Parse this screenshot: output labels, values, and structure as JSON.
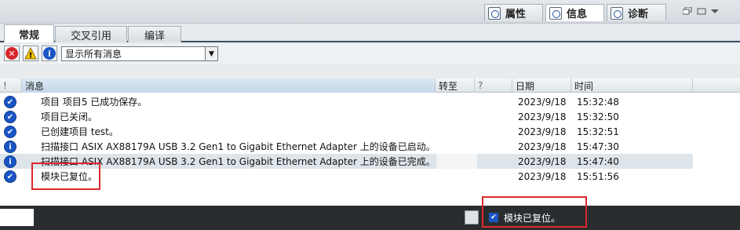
{
  "top_tabs": [
    {
      "label": "属性",
      "icon": "properties-icon",
      "active": false
    },
    {
      "label": "信息",
      "icon": "info-icon",
      "active": true
    },
    {
      "label": "诊断",
      "icon": "diagnostics-icon",
      "active": false
    }
  ],
  "sub_tabs": [
    {
      "label": "常规",
      "active": true
    },
    {
      "label": "交叉引用",
      "active": false
    },
    {
      "label": "编译",
      "active": false
    }
  ],
  "filter": {
    "selected": "显示所有消息",
    "buttons": [
      "error-filter-icon",
      "warning-filter-icon",
      "info-filter-icon"
    ]
  },
  "table": {
    "headers": {
      "flag": "!",
      "message": "消息",
      "goto": "转至",
      "help": "?",
      "date": "日期",
      "time": "时间"
    },
    "rows": [
      {
        "icon": "check-icon",
        "message": "项目 项目5 已成功保存。",
        "date": "2023/9/18",
        "time": "15:32:48"
      },
      {
        "icon": "check-icon",
        "message": "项目已关闭。",
        "date": "2023/9/18",
        "time": "15:32:50"
      },
      {
        "icon": "check-icon",
        "message": "已创建项目 test。",
        "date": "2023/9/18",
        "time": "15:32:51"
      },
      {
        "icon": "info-icon",
        "message": "扫描接口 ASIX AX88179A USB 3.2 Gen1 to Gigabit Ethernet Adapter 上的设备已启动。",
        "date": "2023/9/18",
        "time": "15:47:30"
      },
      {
        "icon": "info-icon",
        "message": "扫描接口 ASIX AX88179A USB 3.2 Gen1 to Gigabit Ethernet Adapter 上的设备已完成。...",
        "date": "2023/9/18",
        "time": "15:47:40"
      },
      {
        "icon": "check-icon",
        "message": "模块已复位。",
        "date": "2023/9/18",
        "time": "15:51:56"
      }
    ]
  },
  "status_bar": {
    "message": "模块已复位。"
  },
  "colors": {
    "accent": "#1a55c4",
    "highlight_box": "#e0282c",
    "status_bg": "#2a2d30"
  }
}
